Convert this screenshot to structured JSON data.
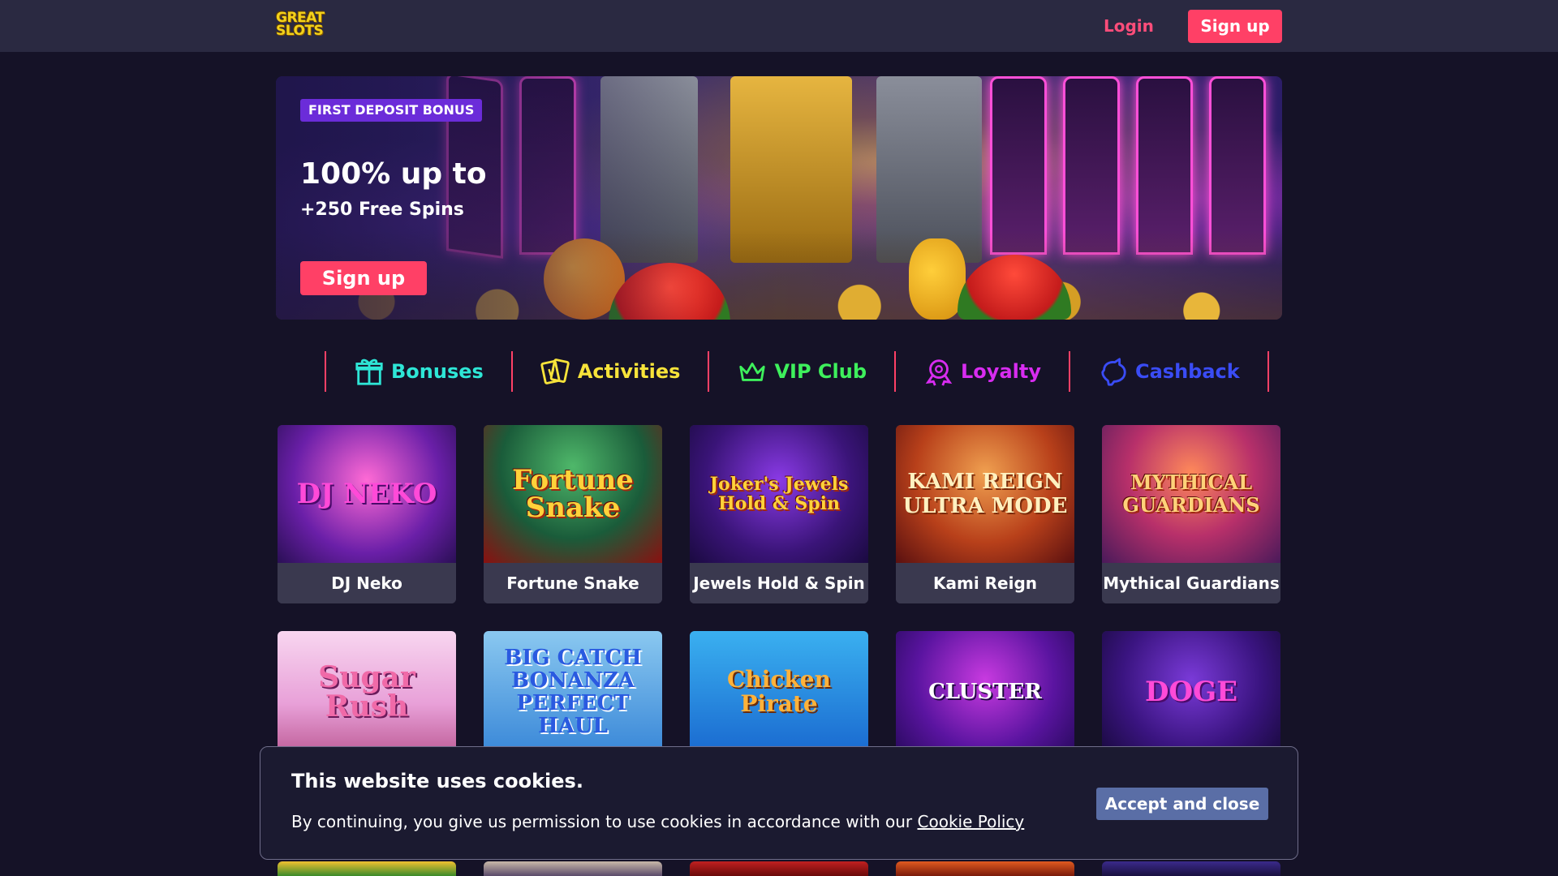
{
  "header": {
    "logo_line1": "GREAT",
    "logo_line2": "SLOTS",
    "login_label": "Login",
    "signup_label": "Sign up"
  },
  "banner": {
    "tag": "FIRST DEPOSIT BONUS",
    "title": "100% up to",
    "subtitle": "+250 Free Spins",
    "button_label": "Sign up"
  },
  "categories": [
    {
      "label": "Bonuses",
      "color": "#2ee6d6",
      "icon": "gift-icon"
    },
    {
      "label": "Activities",
      "color": "#f7e33a",
      "icon": "cards-icon"
    },
    {
      "label": "VIP Club",
      "color": "#3ef05c",
      "icon": "crown-icon"
    },
    {
      "label": "Loyalty",
      "color": "#d82cf0",
      "icon": "badge-icon"
    },
    {
      "label": "Cashback",
      "color": "#3a4cf5",
      "icon": "piggy-bank-icon"
    }
  ],
  "games_row1": [
    {
      "name": "DJ Neko",
      "art_text": "DJ NEKO"
    },
    {
      "name": "Fortune Snake",
      "art_text": "Fortune Snake"
    },
    {
      "name": "Jewels Hold & Spin",
      "art_text": "Joker's Jewels Hold & Spin"
    },
    {
      "name": "Kami Reign",
      "art_text": "KAMI REIGN ULTRA MODE"
    },
    {
      "name": "Mythical Guardians",
      "art_text": "MYTHICAL GUARDIANS"
    }
  ],
  "games_row2": [
    {
      "art_text": "Sugar Rush"
    },
    {
      "art_text": "BIG CATCH BONANZA PERFECT HAUL"
    },
    {
      "art_text": "Chicken Pirate"
    },
    {
      "art_text": "CLUSTER"
    },
    {
      "art_text": "DOGE"
    }
  ],
  "cookie": {
    "title": "This website uses cookies.",
    "text": "By continuing, you give us permission to use cookies in accordance with our",
    "link_label": "Cookie Policy",
    "button_label": "Accept and close"
  },
  "colors": {
    "accent": "#ff4066",
    "background": "#151227",
    "header_bg": "#2a2941",
    "tag_purple": "#6b2cd9",
    "cookie_button": "#5a6ea6"
  }
}
